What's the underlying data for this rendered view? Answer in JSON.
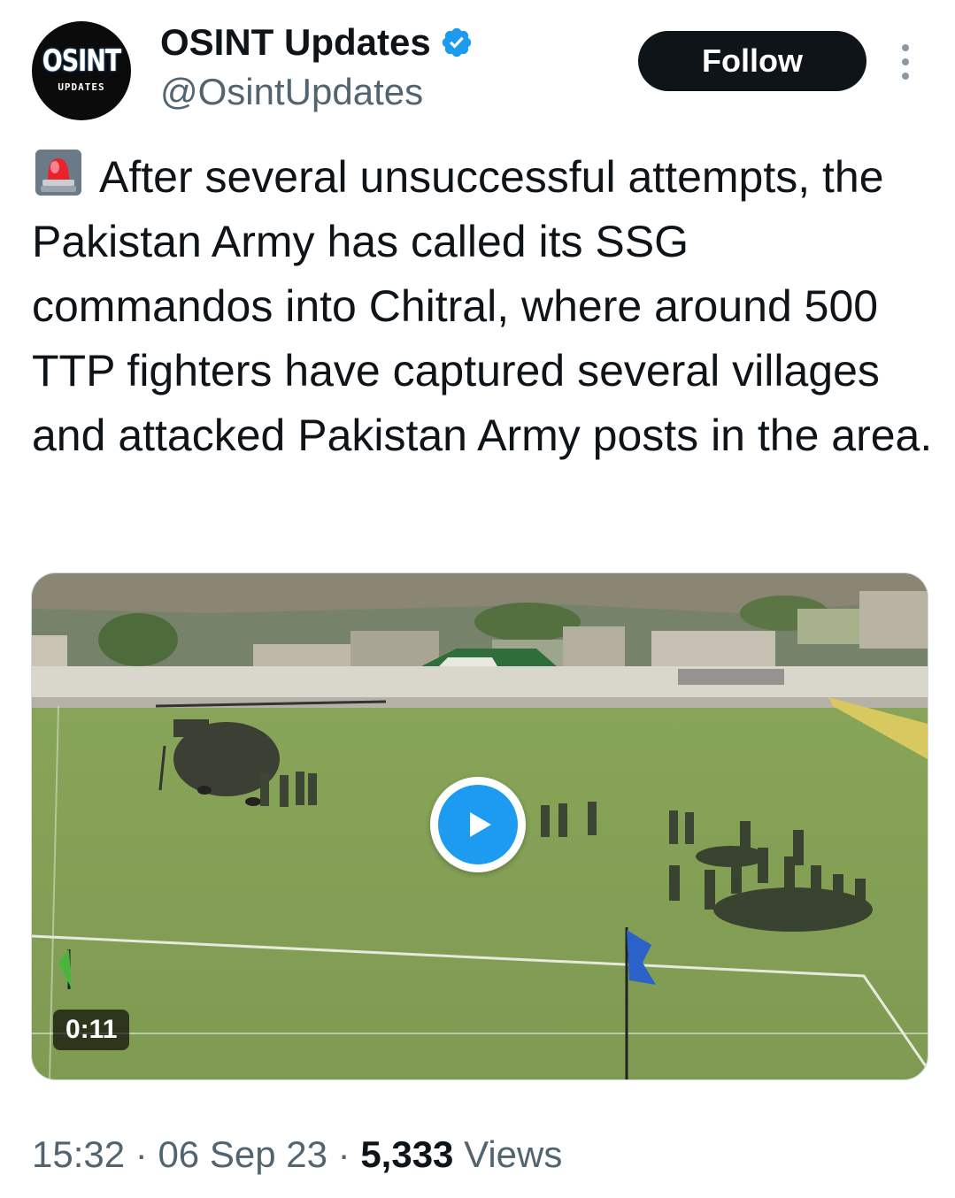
{
  "account": {
    "avatar_text": "OSINT",
    "avatar_subtext": "UPDATES",
    "display_name": "OSINT Updates",
    "handle": "@OsintUpdates"
  },
  "actions": {
    "follow_label": "Follow"
  },
  "tweet": {
    "text": "After several unsuccessful attempts, the Pakistan Army has called its SSG commandos into Chitral, where around 500 TTP fighters have captured several villages and attacked Pakistan Army posts in the area."
  },
  "media": {
    "duration": "0:11"
  },
  "meta": {
    "time": "15:32",
    "separator": "·",
    "date": "06 Sep 23",
    "views_count": "5,333",
    "views_label": "Views"
  },
  "icons": {
    "verified": "verified-badge-icon",
    "more": "more-options-icon",
    "siren": "rotating-light-emoji-icon",
    "play": "play-icon"
  },
  "colors": {
    "accent": "#1d9bf0",
    "text": "#0f1419",
    "secondary_text": "#536471",
    "follow_bg": "#0f1419"
  }
}
